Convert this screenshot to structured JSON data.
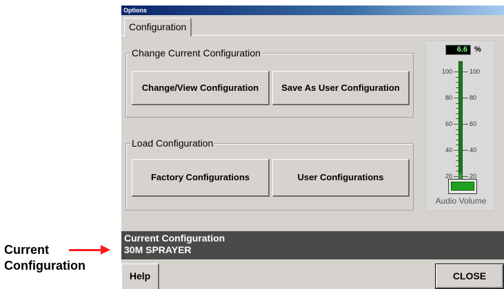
{
  "window": {
    "title": "Options"
  },
  "tabs": [
    {
      "label": "Configuration"
    }
  ],
  "change_group": {
    "title": "Change Current Configuration",
    "buttons": {
      "change_view": "Change/View Configuration",
      "save_as_user": "Save As User Configuration"
    }
  },
  "load_group": {
    "title": "Load Configuration",
    "buttons": {
      "factory": "Factory Configurations",
      "user": "User Configurations"
    }
  },
  "volume": {
    "readout": "6.6",
    "unit": "%",
    "level": 6.6,
    "scale_labels": [
      "100",
      "80",
      "60",
      "40",
      "20"
    ],
    "label": "Audio Volume",
    "colors": {
      "track": "#1f7a1f",
      "readout_text": "#7cff7c"
    }
  },
  "status": {
    "heading": "Current Configuration",
    "value": "30M SPRAYER"
  },
  "footer": {
    "help": "Help",
    "close": "CLOSE"
  },
  "annotation": {
    "line1": "Current",
    "line2": "Configuration",
    "arrow_color": "#ff1a1a"
  }
}
